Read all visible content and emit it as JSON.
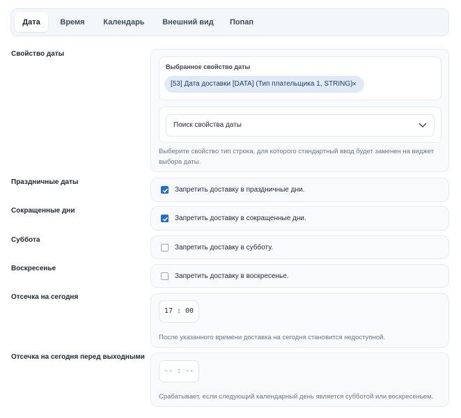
{
  "tabs": [
    {
      "label": "Дата",
      "active": true
    },
    {
      "label": "Время",
      "active": false
    },
    {
      "label": "Календарь",
      "active": false
    },
    {
      "label": "Внешний вид",
      "active": false
    },
    {
      "label": "Попап",
      "active": false
    }
  ],
  "date_property": {
    "label": "Свойство даты",
    "selected_title": "Выбранное свойство даты",
    "selected_chip": "[53] Дата доставки [DATA] (Тип плательщика 1, STRING)",
    "chip_remove": "×",
    "search_placeholder": "Поиск свойства даты",
    "help_line1": "Выберите свойство тип строка, для которого стандартный ввод будет заменен на виджет",
    "help_line2": "выбора даты."
  },
  "holidays": {
    "label": "Праздничные даты",
    "checkbox": "Запретить доставку в праздничные дни.",
    "checked": true
  },
  "short_days": {
    "label": "Сокращенные дни",
    "checkbox": "Запретить доставку в сокращенные дни.",
    "checked": true
  },
  "saturday": {
    "label": "Суббота",
    "checkbox": "Запретить доставку в субботу.",
    "checked": false
  },
  "sunday": {
    "label": "Воскресенье",
    "checkbox": "Запретить доставку в воскресенье.",
    "checked": false
  },
  "cutoff_today": {
    "label": "Отсечка на сегодня",
    "value": "17 : 00",
    "help": "После указанного времени доставка на сегодня становится недоступной."
  },
  "cutoff_before_weekend": {
    "label": "Отсечка на сегодня перед выходными",
    "value": "-- : --",
    "help": "Срабатывает, если следующий календарный день является субботой или воскресеньем."
  },
  "colors": {
    "accent": "#1f6fd1",
    "chip_bg": "#dfeaf6",
    "panel_bg": "#f8fafc"
  }
}
